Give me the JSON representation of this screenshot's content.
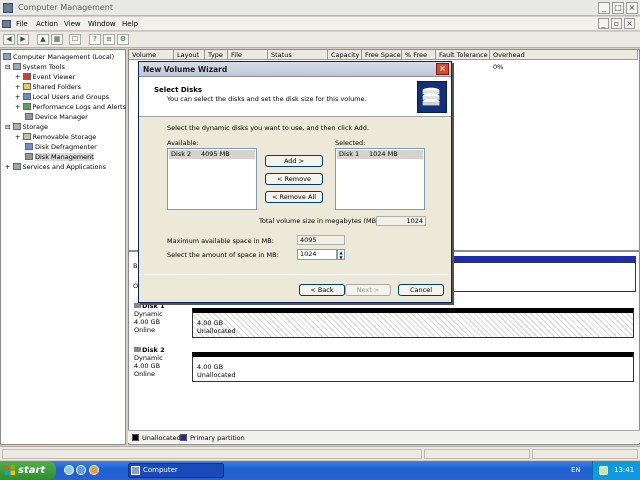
{
  "window": {
    "title": "Computer Management"
  },
  "menu": [
    "File",
    "Action",
    "View",
    "Window",
    "Help"
  ],
  "tree": [
    {
      "label": "Computer Management (Local)",
      "indent": 0
    },
    {
      "label": "System Tools",
      "indent": 1
    },
    {
      "label": "Event Viewer",
      "indent": 2
    },
    {
      "label": "Shared Folders",
      "indent": 2
    },
    {
      "label": "Local Users and Groups",
      "indent": 2
    },
    {
      "label": "Performance Logs and Alerts",
      "indent": 2
    },
    {
      "label": "Device Manager",
      "indent": 2
    },
    {
      "label": "Storage",
      "indent": 1
    },
    {
      "label": "Removable Storage",
      "indent": 2
    },
    {
      "label": "Disk Defragmenter",
      "indent": 2
    },
    {
      "label": "Disk Management",
      "indent": 2,
      "selected": true
    },
    {
      "label": "Services and Applications",
      "indent": 1
    }
  ],
  "columns": [
    "Volume",
    "Layout",
    "Type",
    "File System",
    "Status",
    "Capacity",
    "Free Space",
    "% Free",
    "Fault Tolerance",
    "Overhead"
  ],
  "overhead_value": "0%",
  "disks": [
    {
      "name": "Disk 1",
      "type": "Dynamic",
      "size": "4.00 GB",
      "status": "Online",
      "part_size": "4.00 GB",
      "part_status": "Unallocated"
    },
    {
      "name": "Disk 2",
      "type": "Dynamic",
      "size": "4.00 GB",
      "status": "Online",
      "part_size": "4.00 GB",
      "part_status": "Unallocated"
    }
  ],
  "legend": {
    "unallocated": "Unallocated",
    "primary": "Primary partition",
    "colors": {
      "unallocated": "#000000",
      "primary": "#1c2cae"
    }
  },
  "wizard": {
    "title": "New Volume Wizard",
    "header_title": "Select Disks",
    "header_subtitle": "You can select the disks and set the disk size for this volume.",
    "instruction": "Select the dynamic disks you want to use, and then click Add.",
    "available_label": "Available:",
    "selected_label": "Selected:",
    "available_items": [
      {
        "disk": "Disk 2",
        "size": "4095 MB"
      }
    ],
    "selected_items": [
      {
        "disk": "Disk 1",
        "size": "1024 MB"
      }
    ],
    "add_button": "Add >",
    "remove_button": "< Remove",
    "remove_all_button": "< Remove All",
    "total_label": "Total volume size in megabytes (MB):",
    "total_value": "1024",
    "max_label": "Maximum available space in MB:",
    "max_value": "4095",
    "amount_label": "Select the amount of space in MB:",
    "amount_value": "1024",
    "back_button": "< Back",
    "next_button": "Next >",
    "cancel_button": "Cancel"
  },
  "taskbar": {
    "start_label": "start",
    "task_label": "Computer Management",
    "language": "EN",
    "clock": "13:41"
  }
}
